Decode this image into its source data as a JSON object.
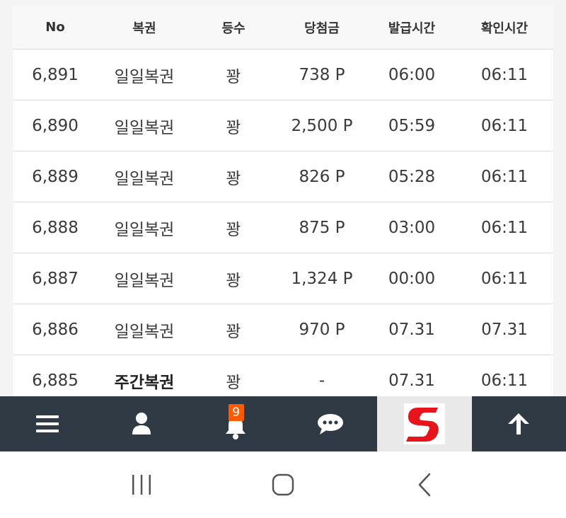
{
  "table": {
    "headers": {
      "no": "No",
      "name": "복권",
      "rank": "등수",
      "prize": "당첨금",
      "issued": "발급시간",
      "checked": "확인시간"
    },
    "rows": [
      {
        "no": "6,891",
        "name": "일일복권",
        "rank": "꽝",
        "prize": "738 P",
        "issued": "06:00",
        "checked": "06:11"
      },
      {
        "no": "6,890",
        "name": "일일복권",
        "rank": "꽝",
        "prize": "2,500 P",
        "issued": "05:59",
        "checked": "06:11"
      },
      {
        "no": "6,889",
        "name": "일일복권",
        "rank": "꽝",
        "prize": "826 P",
        "issued": "05:28",
        "checked": "06:11"
      },
      {
        "no": "6,888",
        "name": "일일복권",
        "rank": "꽝",
        "prize": "875 P",
        "issued": "03:00",
        "checked": "06:11"
      },
      {
        "no": "6,887",
        "name": "일일복권",
        "rank": "꽝",
        "prize": "1,324 P",
        "issued": "00:00",
        "checked": "06:11"
      },
      {
        "no": "6,886",
        "name": "일일복권",
        "rank": "꽝",
        "prize": "970 P",
        "issued": "07.31",
        "checked": "07.31"
      },
      {
        "no": "6,885",
        "name": "주간복권",
        "rank": "꽝",
        "prize": "-",
        "issued": "07.31",
        "checked": "06:11"
      }
    ]
  },
  "bottom_nav": {
    "items": [
      {
        "icon": "menu-icon"
      },
      {
        "icon": "user-icon"
      },
      {
        "icon": "bell-icon",
        "badge": "9"
      },
      {
        "icon": "chat-icon"
      },
      {
        "icon": "s-logo"
      },
      {
        "icon": "arrow-up-icon"
      }
    ]
  },
  "system_nav": {
    "items": [
      {
        "icon": "recent-apps-icon"
      },
      {
        "icon": "home-icon"
      },
      {
        "icon": "back-icon"
      }
    ]
  },
  "colors": {
    "nav_bg": "#2f3a45",
    "badge": "#ff5a00",
    "logo_red": "#e8141b"
  }
}
